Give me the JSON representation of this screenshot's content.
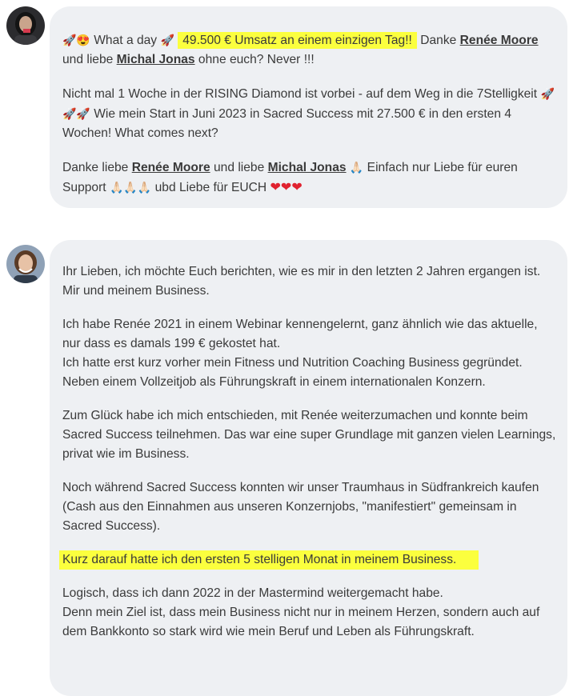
{
  "post1": {
    "emoji_start": "🚀😍",
    "what_a_day": "What a day",
    "rocket": "🚀",
    "highlight": "49.500 € Umsatz an einem einzigen Tag!!",
    "danke": "Danke",
    "name1": "Renée Moore",
    "und_liebe": "und liebe",
    "name2": "Michal Jonas",
    "ohne": "ohne euch? Never !!!",
    "para2_a": "Nicht mal 1 Woche in der RISING Diamond ist vorbei - auf dem Weg in die 7Stelligkeit",
    "rockets3": "🚀🚀🚀",
    "para2_b": "Wie mein Start in Juni 2023 in Sacred Success mit 27.500 € in den ersten 4 Wochen! What comes next?",
    "para3_danke": "Danke liebe",
    "para3_name1": "Renée Moore",
    "para3_und": "und liebe",
    "para3_name2": "Michal Jonas",
    "pray1": "🙏🏻",
    "para3_a": "Einfach nur Liebe für euren Support",
    "pray3": "🙏🏻🙏🏻🙏🏻",
    "para3_b": "ubd Liebe für EUCH",
    "hearts": "❤❤❤"
  },
  "post2": {
    "p1": "Ihr Lieben, ich möchte Euch berichten, wie es mir in den letzten 2 Jahren ergangen ist. Mir und meinem Business.",
    "p2a": "Ich habe Renée 2021 in einem Webinar kennengelernt, ganz ähnlich wie das aktuelle, nur dass es damals 199 € gekostet hat.",
    "p2b": "Ich hatte erst kurz vorher mein Fitness und Nutrition Coaching Business gegründet. Neben einem Vollzeitjob als Führungskraft in einem internationalen Konzern.",
    "p3": "Zum Glück habe ich mich entschieden, mit Renée weiterzumachen und konnte beim Sacred Success teilnehmen. Das war eine super Grundlage mit ganzen vielen Learnings, privat wie im Business.",
    "p4": "Noch während Sacred Success konnten wir unser Traumhaus in Südfrankreich kaufen (Cash aus den Einnahmen aus unseren Konzernjobs, \"manifestiert\" gemeinsam in Sacred Success).",
    "p5": "Kurz darauf hatte ich den ersten 5 stelligen Monat in meinem Business.",
    "p6a": "Logisch, dass ich dann 2022 in der Mastermind weitergemacht habe.",
    "p6b": "Denn mein Ziel ist, dass mein Business nicht nur in meinem Herzen, sondern auch auf dem Bankkonto so stark wird wie mein Beruf und Leben als Führungskraft."
  },
  "colors": {
    "bubble": "#eef0f3",
    "highlight": "#fbff3e",
    "heart": "#e0222f"
  }
}
